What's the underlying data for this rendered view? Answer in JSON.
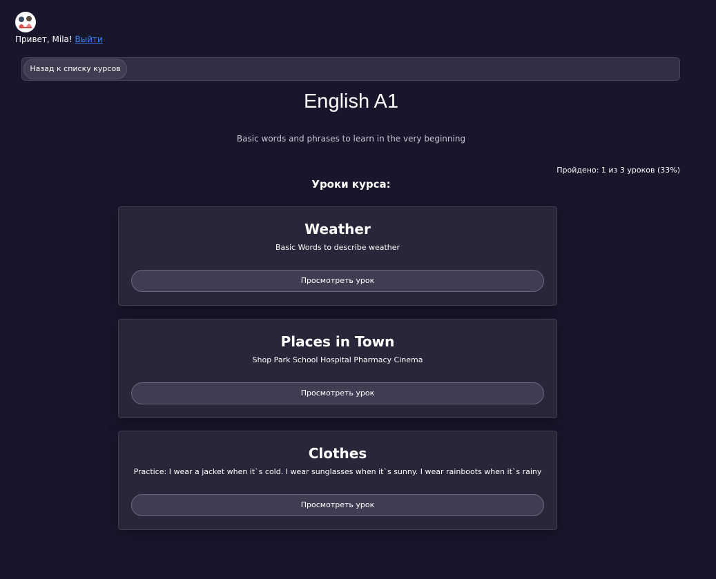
{
  "header": {
    "greeting": "Привет, Mila!",
    "logout_label": "Выйти"
  },
  "nav": {
    "back_label": "Назад к списку курсов"
  },
  "course": {
    "title": "English A1",
    "description": "Basic words and phrases to learn in the very beginning",
    "progress_text": "Пройдено: 1 из 3 уроков (33%)",
    "lessons_heading": "Уроки курса:"
  },
  "lessons": [
    {
      "title": "Weather",
      "description": "Basic Words to describe weather",
      "button_label": "Просмотреть урок"
    },
    {
      "title": "Places in Town",
      "description": "Shop Park School Hospital Pharmacy Cinema",
      "button_label": "Просмотреть урок"
    },
    {
      "title": "Clothes",
      "description": "Practice: I wear a jacket when it`s cold. I wear sunglasses when it`s sunny. I wear rainboots when it`s rainy",
      "button_label": "Просмотреть урок"
    }
  ]
}
